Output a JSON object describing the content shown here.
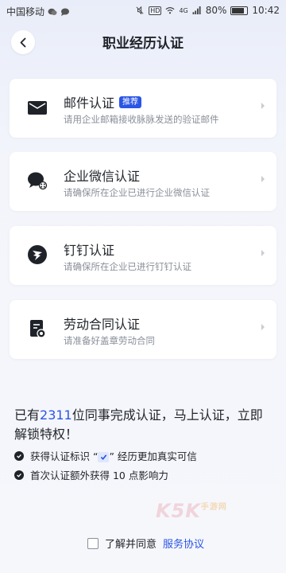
{
  "status_bar": {
    "carrier": "中国移动",
    "hd": "HD",
    "network": "4G",
    "battery": "80%",
    "battery_level": 0.8,
    "time": "10:42"
  },
  "header": {
    "title": "职业经历认证"
  },
  "cards": [
    {
      "title": "邮件认证",
      "badge": "推荐",
      "desc": "请用企业邮箱接收脉脉发送的验证邮件",
      "icon": "envelope-icon"
    },
    {
      "title": "企业微信认证",
      "desc": "请确保所在企业已进行企业微信认证",
      "icon": "wecom-icon"
    },
    {
      "title": "钉钉认证",
      "desc": "请确保所在企业已进行钉钉认证",
      "icon": "dingtalk-icon"
    },
    {
      "title": "劳动合同认证",
      "desc": "请准备好盖章劳动合同",
      "icon": "contract-icon"
    }
  ],
  "promo": {
    "prefix": "已有",
    "count": "2311",
    "suffix": "位同事完成认证，马上认证，立即解锁特权！"
  },
  "benefits": [
    {
      "before": "获得认证标识 “",
      "after": "” 经历更加真实可信"
    },
    {
      "text": "首次认证额外获得 10 点影响力"
    }
  ],
  "agreement": {
    "text": "了解并同意",
    "link": "服务协议"
  },
  "watermark": {
    "main": "K5K",
    "sub": "手游网"
  },
  "colors": {
    "accent": "#2a55e5",
    "text": "#1f2329",
    "muted": "#8a8f99"
  }
}
